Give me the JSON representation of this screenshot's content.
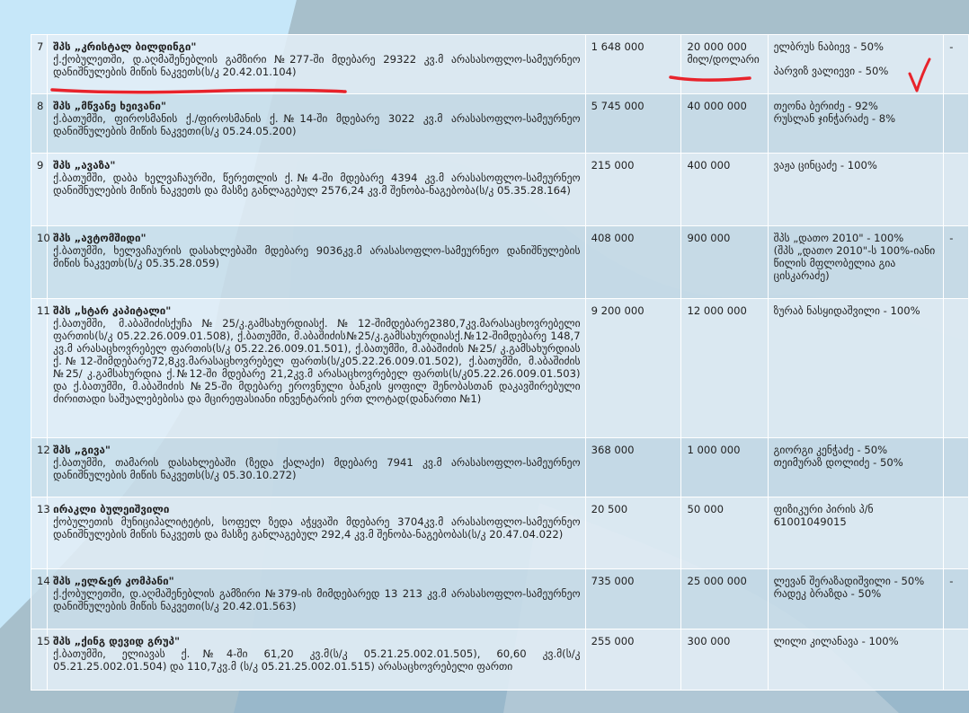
{
  "rows": [
    {
      "num": "7",
      "name": "შპს „კრისტალ ბილდინგი\"",
      "address": "ქ.ქობულეთში, დ.აღმაშენებლის გამზირი №277-ში მდებარე 29322 კვ.მ არასასოფლო-სამეურნეო დანიშნულების მიწის ნაკვეთს(ს/კ 20.42.01.104)",
      "amount": "1 648 000",
      "value": "20 000 000 მილ/დოლარი",
      "owners": [
        "ელბრუს ნაბიევ - 50%",
        "პარვიზ ვალიევი - 50%"
      ],
      "extra": "-"
    },
    {
      "num": "8",
      "name": "შპს „მწვანე ხეივანი\"",
      "address": "ქ.ბათუმში, ფიროსმანის ქ./ფიროსმანის ქ.№14-ში მდებარე 3022 კვ.მ არასასოფლო-სამეურნეო დანიშნულების მიწის ნაკვეთი(ს/კ 05.24.05.200)",
      "amount": "5 745 000",
      "value": "40 000 000",
      "owners": [
        "თეონა ბერიძე - 92%",
        "რუსლან ჯინჭარაძე - 8%"
      ],
      "extra": ""
    },
    {
      "num": "9",
      "name": "შპს „ავაზა\"",
      "address": "ქ.ბათუმში, დაბა ხელვაჩაურში, წერეთლის ქ.№4-ში მდებარე 4394 კვ.მ არასასოფლო-სამეურნეო დანიშნულების მიწის ნაკვეთს და მასზე განლაგებულ 2576,24 კვ.მ შენობა-ნაგებობა(ს/კ 05.35.28.164)",
      "amount": "215 000",
      "value": "400 000",
      "owners": [
        "ვაჟა ცინცაძე - 100%"
      ],
      "extra": ""
    },
    {
      "num": "10",
      "name": "შპს „ავტომშიდი\"",
      "address": "ქ.ბათუმში, ხელვაჩაურის დასახლებაში მდებარე 9036კვ.მ არასასოფლო-სამეურნეო დანიშნულების მიწის ნაკვეთს(ს/კ 05.35.28.059)",
      "amount": "408 000",
      "value": "900 000",
      "owners": [
        "შპს „დათო 2010\" - 100%",
        "(შპს „დათო 2010\"-ს 100%-იანი წილის მფლობელია გია ცისკარაძე)"
      ],
      "extra": "-"
    },
    {
      "num": "11",
      "name": "შპს „სტარ კაპიტალი\"",
      "address": "ქ.ბათუმში, მ.აბაშიძისქუჩა№25/კ.გამსახურდიასქ.№12-შიმდებარე2380,7კვ.მარასაცხოვრებელი ფართის(ს/კ 05.22.26.009.01.508), ქ.ბათუმში, მ.აბაშიძის№25/კ.გამსახურდიასქ.№12-შიმდებარე 148,7 კვ.მ არასაცხოვრებელ ფართის(ს/კ 05.22.26.009.01.501), ქ.ბათუმში, მ.აბაშიძის №25/ კ.გამსახურდიას ქ.№12-შიმდებარე72,8კვ.მარასაცხოვრებელ ფართს(ს/კ05.22.26.009.01.502), ქ.ბათუმში, მ.აბაშიძის №25/ კ.გამსახურდია ქ.№12-ში მდებარე 21,2კვ.მ არასაცხოვრებელ ფართს(ს/კ05.22.26.009.01.503) და ქ.ბათუმში, მ.აბაშიძის №25-ში მდებარე ეროვნული ბანკის ყოფილ შენობასთან დაკავშირებული ძირითადი საშუალებებისა და მცირეფასიანი ინვენტარის ერთ ლოტად(დანართი №1)",
      "amount": "9 200 000",
      "value": "12 000 000",
      "owners": [
        "ზურაბ ნასყიდაშვილი - 100%"
      ],
      "extra": ""
    },
    {
      "num": "12",
      "name": "შპს „გივა\"",
      "address": "ქ.ბათუმში, თამარის დასახლებაში (ზედა ქალაქი) მდებარე 7941 კვ.მ არასასოფლო-სამეურნეო დანიშნულების მიწის ნაკვეთს(ს/კ 05.30.10.272)",
      "amount": "368 000",
      "value": "1 000 000",
      "owners": [
        "გიორგი კენჭაძე - 50%",
        "თეიმურაზ დოლიძე - 50%"
      ],
      "extra": ""
    },
    {
      "num": "13",
      "name": "ირაკლი ბულეიშვილი",
      "address": "ქობულეთის მუნიციპალიტეტის, სოფელ ზედა აჭყვაში მდებარე 3704კვ.მ არასასოფლო-სამეურნეო დანიშნულების მიწის ნაკვეთს და მასზე განლაგებულ 292,4 კვ.მ შენობა-ნაგებობას(ს/კ 20.47.04.022)",
      "amount": "20 500",
      "value": "50 000",
      "owners": [
        "ფიზიკური პირის პ/ნ 61001049015"
      ],
      "extra": ""
    },
    {
      "num": "14",
      "name": "შპს „ელ&ერ კომპანი\"",
      "address": "ქ.ქობულეთში, დ.აღმაშენებლის გამზირი №379-ის მიმდებარედ 13 213 კვ.მ არასასოფლო-სამეურნეო დანიშნულების მიწის ნაკვეთი(ს/კ 20.42.01.563)",
      "amount": "735 000",
      "value": "25 000 000",
      "owners": [
        "ლევან შერაზადიშვილი - 50%",
        "რადეკ ბრაზდა - 50%"
      ],
      "extra": "-"
    },
    {
      "num": "15",
      "name": "შპს „ქინგ დევიდ გრუპ\"",
      "address": "ქ.ბათუმში, ელიავას ქ.№4-ში 61,20 კვ.მ(ს/კ 05.21.25.002.01.505), 60,60 კვ.მ(ს/კ 05.21.25.002.01.504) და 110,7კვ.მ (ს/კ 05.21.25.002.01.515) არასაცხოვრებელი ფართი",
      "amount": "255 000",
      "value": "300 000",
      "owners": [
        "ლილი კილანავა - 100%"
      ],
      "extra": ""
    }
  ]
}
